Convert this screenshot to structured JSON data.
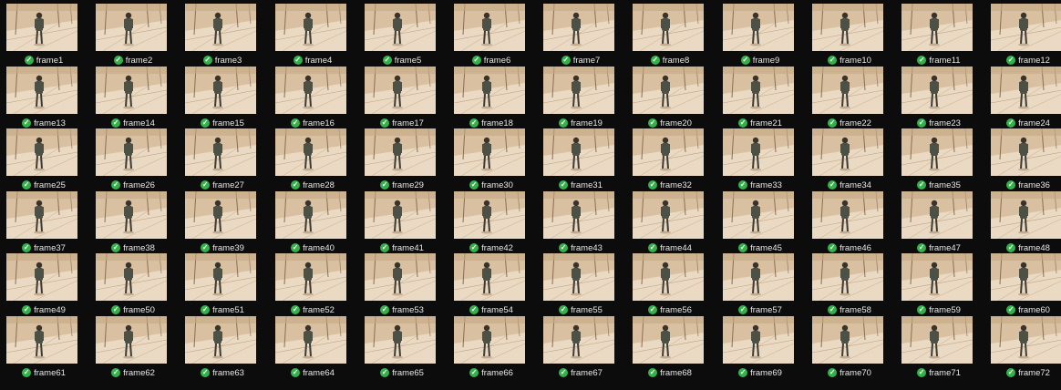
{
  "view": {
    "rows": 6,
    "columns": 12
  },
  "colors": {
    "background": "#0c0c0c",
    "caption_text": "#e8e8e8",
    "status_check": "#33b24a"
  },
  "status_icon": "check-circle-icon",
  "thumbnail_icon": "frame-thumbnail-image",
  "frames": [
    {
      "label": "frame1"
    },
    {
      "label": "frame2"
    },
    {
      "label": "frame3"
    },
    {
      "label": "frame4"
    },
    {
      "label": "frame5"
    },
    {
      "label": "frame6"
    },
    {
      "label": "frame7"
    },
    {
      "label": "frame8"
    },
    {
      "label": "frame9"
    },
    {
      "label": "frame10"
    },
    {
      "label": "frame11"
    },
    {
      "label": "frame12"
    },
    {
      "label": "frame13"
    },
    {
      "label": "frame14"
    },
    {
      "label": "frame15"
    },
    {
      "label": "frame16"
    },
    {
      "label": "frame17"
    },
    {
      "label": "frame18"
    },
    {
      "label": "frame19"
    },
    {
      "label": "frame20"
    },
    {
      "label": "frame21"
    },
    {
      "label": "frame22"
    },
    {
      "label": "frame23"
    },
    {
      "label": "frame24"
    },
    {
      "label": "frame25"
    },
    {
      "label": "frame26"
    },
    {
      "label": "frame27"
    },
    {
      "label": "frame28"
    },
    {
      "label": "frame29"
    },
    {
      "label": "frame30"
    },
    {
      "label": "frame31"
    },
    {
      "label": "frame32"
    },
    {
      "label": "frame33"
    },
    {
      "label": "frame34"
    },
    {
      "label": "frame35"
    },
    {
      "label": "frame36"
    },
    {
      "label": "frame37"
    },
    {
      "label": "frame38"
    },
    {
      "label": "frame39"
    },
    {
      "label": "frame40"
    },
    {
      "label": "frame41"
    },
    {
      "label": "frame42"
    },
    {
      "label": "frame43"
    },
    {
      "label": "frame44"
    },
    {
      "label": "frame45"
    },
    {
      "label": "frame46"
    },
    {
      "label": "frame47"
    },
    {
      "label": "frame48"
    },
    {
      "label": "frame49"
    },
    {
      "label": "frame50"
    },
    {
      "label": "frame51"
    },
    {
      "label": "frame52"
    },
    {
      "label": "frame53"
    },
    {
      "label": "frame54"
    },
    {
      "label": "frame55"
    },
    {
      "label": "frame56"
    },
    {
      "label": "frame57"
    },
    {
      "label": "frame58"
    },
    {
      "label": "frame59"
    },
    {
      "label": "frame60"
    },
    {
      "label": "frame61"
    },
    {
      "label": "frame62"
    },
    {
      "label": "frame63"
    },
    {
      "label": "frame64"
    },
    {
      "label": "frame65"
    },
    {
      "label": "frame66"
    },
    {
      "label": "frame67"
    },
    {
      "label": "frame68"
    },
    {
      "label": "frame69"
    },
    {
      "label": "frame70"
    },
    {
      "label": "frame71"
    },
    {
      "label": "frame72"
    }
  ]
}
